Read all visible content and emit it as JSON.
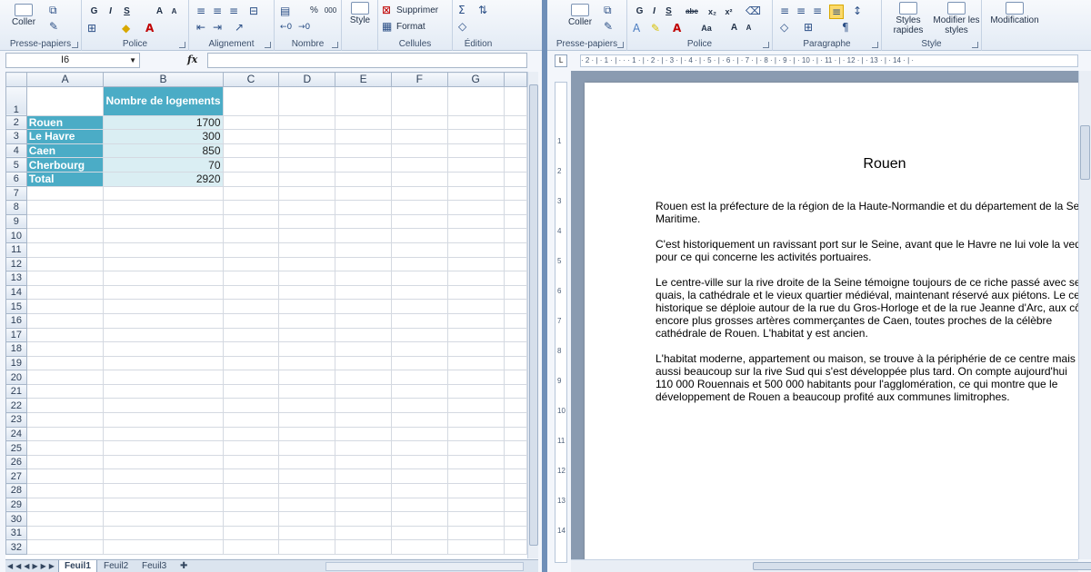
{
  "excel": {
    "ribbon": {
      "clipboard": {
        "label": "Presse-papiers",
        "paste": "Coller"
      },
      "font": {
        "label": "Police",
        "bold": "G",
        "italic": "I",
        "underline": "S",
        "grow": "A",
        "shrink": "A"
      },
      "alignment": {
        "label": "Alignement"
      },
      "number": {
        "label": "Nombre",
        "percent": "%",
        "thousands": "000"
      },
      "styles": {
        "style": "Style"
      },
      "cells": {
        "label": "Cellules",
        "delete": "Supprimer",
        "format": "Format"
      },
      "editing": {
        "label": "Édition"
      }
    },
    "name_box": "I6",
    "fx": "fx",
    "columns": [
      "A",
      "B",
      "C",
      "D",
      "E",
      "F",
      "G"
    ],
    "header_cell": "Nombre de logements",
    "rows": [
      {
        "city": "Rouen",
        "value": "1700"
      },
      {
        "city": "Le Havre",
        "value": "300"
      },
      {
        "city": "Caen",
        "value": "850"
      },
      {
        "city": "Cherbourg",
        "value": "70"
      },
      {
        "city": "Total",
        "value": "2920"
      }
    ],
    "row_numbers": [
      "1",
      "2",
      "3",
      "4",
      "5",
      "6",
      "7",
      "8",
      "9",
      "10",
      "11",
      "12",
      "13",
      "14",
      "15",
      "16",
      "17",
      "18",
      "19",
      "20",
      "21",
      "22",
      "23",
      "24",
      "25",
      "26",
      "27",
      "28",
      "29",
      "30",
      "31",
      "32"
    ],
    "sheets": [
      "Feuil1",
      "Feuil2",
      "Feuil3"
    ]
  },
  "word": {
    "ribbon": {
      "clipboard": {
        "label": "Presse-papiers",
        "paste": "Coller"
      },
      "font": {
        "label": "Police",
        "bold": "G",
        "italic": "I",
        "underline": "S",
        "strike": "abc",
        "sub": "x₂",
        "sup": "x²",
        "case": "Aa",
        "grow": "A",
        "shrink": "A"
      },
      "paragraph": {
        "label": "Paragraphe",
        "pilcrow": "¶"
      },
      "styles": {
        "label": "Style",
        "quick": "Styles rapides",
        "change": "Modifier les styles"
      },
      "editing": {
        "label": "Modification"
      }
    },
    "ruler_marks": "· 2 · | · 1 · | · · · 1 · | · 2 · | · 3 · | · 4 · | · 5 · | · 6 · | · 7 · | · 8 · | · 9 · | · 10 · | · 11 · | · 12 · | · 13 · | · 14 · | ·",
    "vruler_marks": [
      "1",
      "2",
      "3",
      "4",
      "5",
      "6",
      "7",
      "8",
      "9",
      "10",
      "11",
      "12",
      "13",
      "14"
    ],
    "title": "Rouen",
    "paragraphs": [
      [
        "Rouen est la préfecture de la région de la Haute-Normandie et du département de la Seine-",
        "Maritime."
      ],
      [
        "C'est historiquement un ravissant port sur le Seine, avant que le Havre ne lui vole la vedette",
        "pour ce qui concerne les activités portuaires."
      ],
      [
        "Le centre-ville sur la rive droite de la Seine témoigne toujours de ce riche passé avec ses",
        "quais, la cathédrale et le vieux quartier médiéval, maintenant réservé aux piétons. Le centre",
        "historique se déploie autour de la rue du Gros-Horloge et de la rue Jeanne d'Arc, aux côtés",
        "encore plus grosses artères commerçantes de Caen, toutes proches de la célèbre",
        "cathédrale de Rouen. L'habitat y est ancien."
      ],
      [
        "L'habitat moderne, appartement ou maison, se trouve à la périphérie de ce centre mais",
        "aussi beaucoup sur la rive Sud qui s'est développée plus tard. On compte aujourd'hui",
        "110 000 Rouennais et 500 000 habitants pour l'agglomération, ce qui montre que le",
        "développement de Rouen a beaucoup profité aux communes limitrophes."
      ]
    ]
  }
}
